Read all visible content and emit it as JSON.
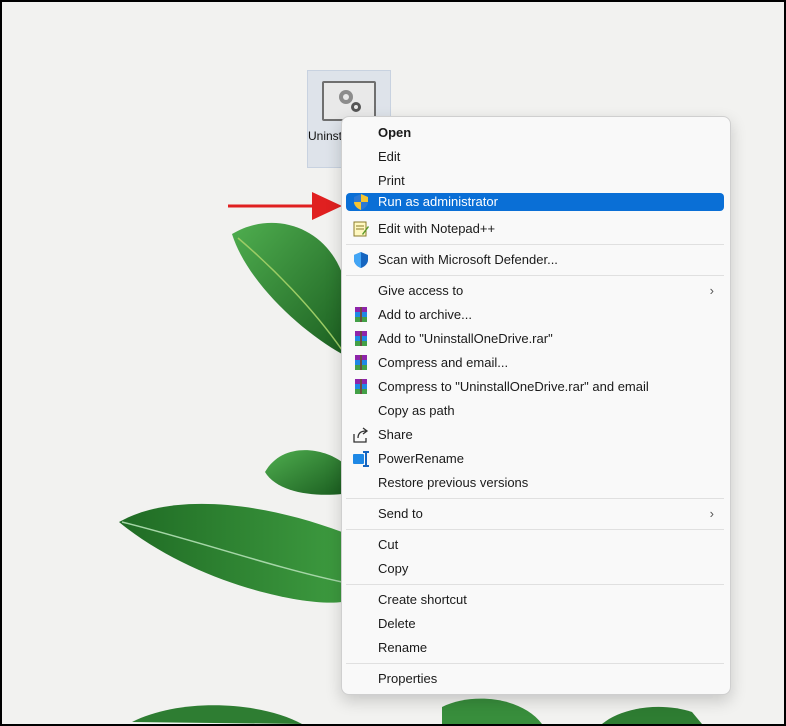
{
  "desktop": {
    "file_label": "UninstallOneDrive"
  },
  "context_menu": {
    "items": [
      {
        "label": "Open"
      },
      {
        "label": "Edit"
      },
      {
        "label": "Print"
      },
      {
        "label": "Run as administrator",
        "icon": "uac-shield-icon",
        "highlighted": true
      },
      {
        "label": "Edit with Notepad++",
        "icon": "notepad-plus-plus-icon"
      },
      {
        "label": "Scan with Microsoft Defender...",
        "icon": "defender-shield-icon"
      },
      {
        "label": "Give access to",
        "submenu": true
      },
      {
        "label": "Add to archive...",
        "icon": "winrar-icon"
      },
      {
        "label": "Add to \"UninstallOneDrive.rar\"",
        "icon": "winrar-icon"
      },
      {
        "label": "Compress and email...",
        "icon": "winrar-icon"
      },
      {
        "label": "Compress to \"UninstallOneDrive.rar\" and email",
        "icon": "winrar-icon"
      },
      {
        "label": "Copy as path"
      },
      {
        "label": "Share",
        "icon": "share-icon"
      },
      {
        "label": "PowerRename",
        "icon": "powerrename-icon"
      },
      {
        "label": "Restore previous versions"
      },
      {
        "label": "Send to",
        "submenu": true
      },
      {
        "label": "Cut"
      },
      {
        "label": "Copy"
      },
      {
        "label": "Create shortcut"
      },
      {
        "label": "Delete"
      },
      {
        "label": "Rename"
      },
      {
        "label": "Properties"
      }
    ]
  },
  "colors": {
    "highlight": "#0a6fd6",
    "arrow": "#e02020",
    "leaf_green": "#2e7d32"
  }
}
